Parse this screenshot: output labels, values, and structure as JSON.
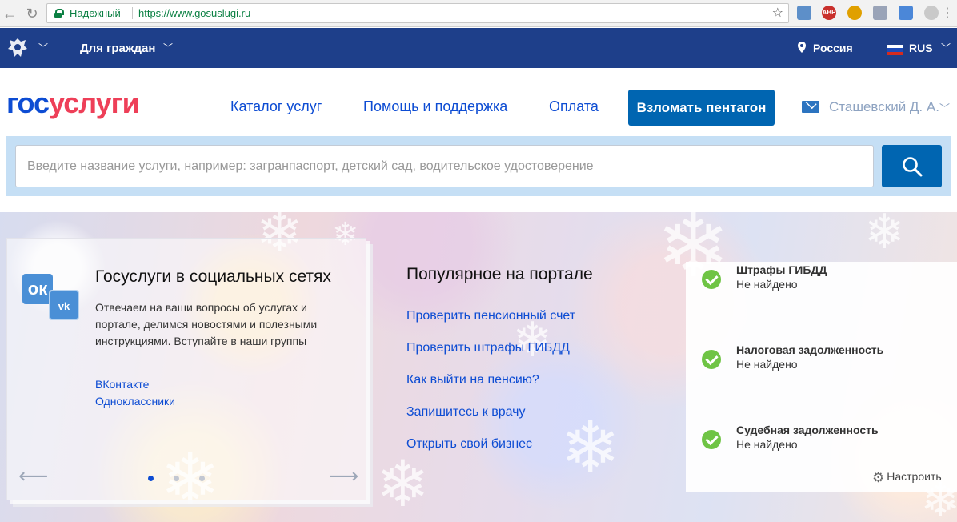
{
  "browser": {
    "secure_label": "Надежный",
    "url": "https://www.gosuslugi.ru",
    "extensions": [
      "ABP"
    ]
  },
  "topbar": {
    "for_citizens": "Для граждан",
    "region": "Россия",
    "language": "RUS",
    "flag_colors": [
      "#ffffff",
      "#1c4ab8",
      "#d52b1e"
    ]
  },
  "header": {
    "logo_part1": "гос",
    "logo_part2": "услуги",
    "nav": [
      "Каталог услуг",
      "Помощь и поддержка",
      "Оплата"
    ],
    "action_button": "Взломать пентагон",
    "user_name": "Сташевский Д. А."
  },
  "search": {
    "placeholder": "Введите название услуги, например: загранпаспорт, детский сад, водительское удостоверение",
    "value": ""
  },
  "social": {
    "title": "Госуслуги в социальных сетях",
    "description": "Отвечаем на ваши вопросы об услугах и портале, делимся новостями и полезными инструкциями. Вступайте в наши группы",
    "links": [
      "ВКонтакте",
      "Одноклассники"
    ],
    "icons": [
      "odnoklassniki-icon",
      "vkontakte-icon"
    ],
    "carousel_dots": 3,
    "active_dot": 0,
    "ok_glyph": "ок",
    "vk_glyph": "vk"
  },
  "popular": {
    "title": "Популярное на портале",
    "links": [
      "Проверить пенсионный счет",
      "Проверить штрафы ГИБДД",
      "Как выйти на пенсию?",
      "Запишитесь к врачу",
      "Открыть свой бизнес"
    ]
  },
  "checks": {
    "items": [
      {
        "title": "Штрафы ГИБДД",
        "status": "Не найдено"
      },
      {
        "title": "Налоговая задолженность",
        "status": "Не найдено"
      },
      {
        "title": "Судебная задолженность",
        "status": "Не найдено"
      }
    ],
    "settings_label": "Настроить",
    "status_color": "#6fc445"
  },
  "colors": {
    "brand_blue": "#0d4cd3",
    "brand_red": "#ee3f58",
    "topbar": "#1e3f8a",
    "button": "#0065b1"
  }
}
